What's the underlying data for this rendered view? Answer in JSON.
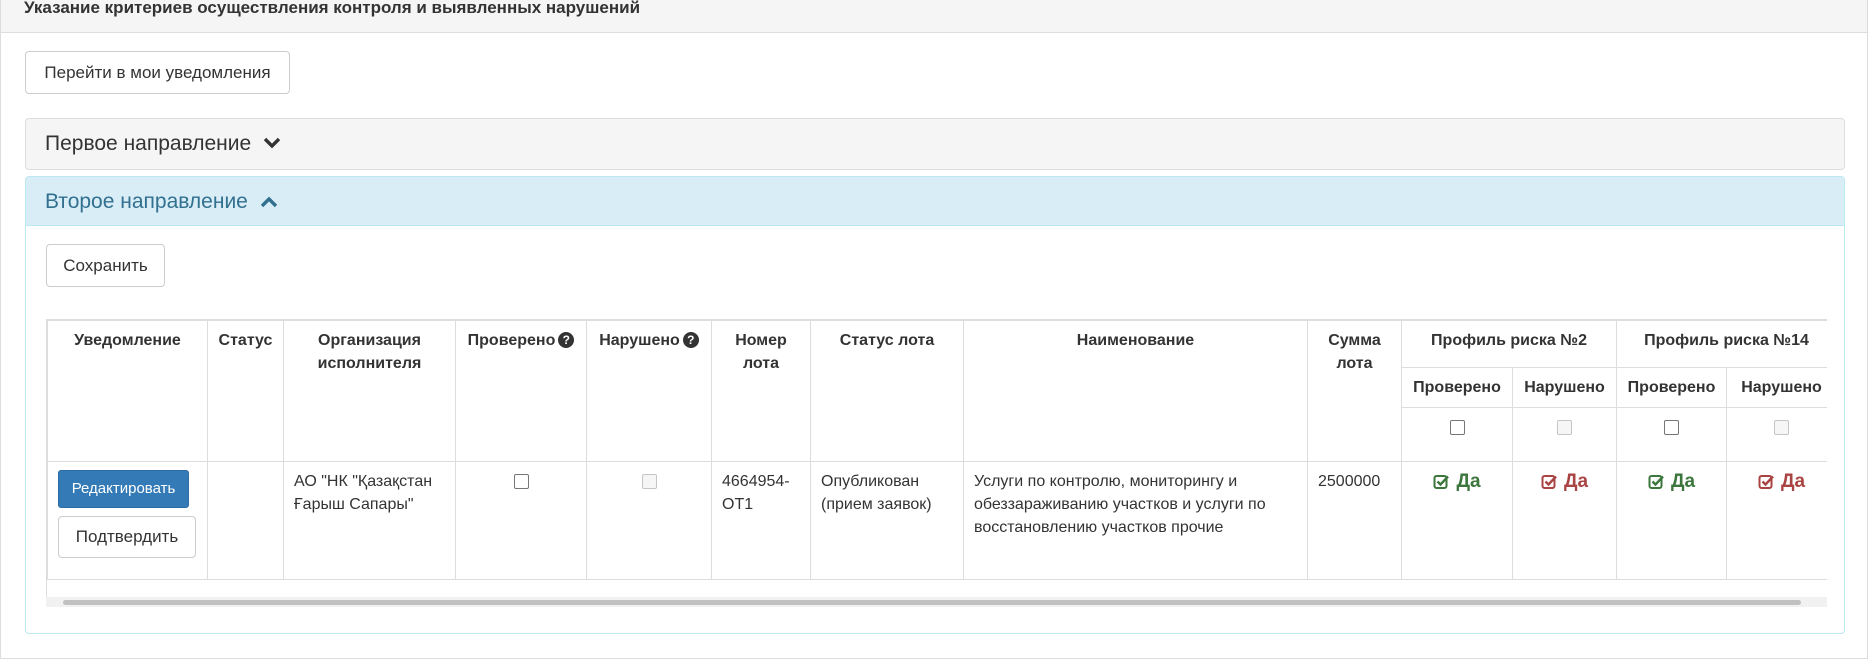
{
  "outer": {
    "title": "Указание критериев осуществления контроля и выявленных нарушений"
  },
  "goto_button": "Перейти в мои уведомления",
  "first_direction": {
    "title": "Первое направление"
  },
  "second_direction": {
    "title": "Второе направление",
    "save_button": "Сохранить",
    "table": {
      "headers": {
        "notification": "Уведомление",
        "status": "Статус",
        "org": "Организация исполнителя",
        "checked": "Проверено",
        "violated": "Нарушено",
        "lot_number": "Номер лота",
        "lot_status": "Статус лота",
        "name": "Наименование",
        "lot_sum": "Сумма лота",
        "risk_profile_2": "Профиль риска №2",
        "risk_profile_14": "Профиль риска №14",
        "sub_checked": "Проверено",
        "sub_violated": "Нарушено"
      },
      "row": {
        "edit_button": "Редактировать",
        "confirm_button": "Подтвердить",
        "status": "",
        "org": "АО \"НК \"Қазақстан Ғарыш Сапары\"",
        "lot_number": "4664954-ОТ1",
        "lot_status": "Опубликован (прием заявок)",
        "name": "Услуги по контролю, мониторингу и обеззараживанию участков и услуги по восстановлению участков прочие",
        "lot_sum": "2500000",
        "yes_label": "Да"
      }
    }
  },
  "colors": {
    "primary": "#337ab7",
    "info_bg": "#d9edf7",
    "info_text": "#31708f",
    "success": "#3c763d",
    "danger": "#a94442"
  },
  "icons": {
    "chevron_down": "chevron-down-icon",
    "chevron_up": "chevron-up-icon",
    "question": "question-circle-icon",
    "check_square": "check-square-icon"
  }
}
